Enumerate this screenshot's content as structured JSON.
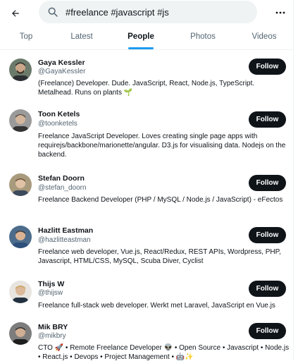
{
  "search": {
    "query": "#freelance #javascript #js"
  },
  "tabs": [
    {
      "label": "Top"
    },
    {
      "label": "Latest"
    },
    {
      "label": "People"
    },
    {
      "label": "Photos"
    },
    {
      "label": "Videos"
    }
  ],
  "active_tab": "People",
  "follow_label": "Follow",
  "users": [
    {
      "name": "Gaya Kessler",
      "handle": "@GayaKessler",
      "bio": "(Freelance) Developer. Dude. JavaScript, React, Node.js, TypeScript. Metalhead. Runs on plants 🌱"
    },
    {
      "name": "Toon Ketels",
      "handle": "@toonketels",
      "bio": "Freelance JavaScript Developer. Loves creating single page apps with requirejs/backbone/marionette/angular. D3.js for visualising data. Nodejs on the backend."
    },
    {
      "name": "Stefan Doorn",
      "handle": "@stefan_doorn",
      "bio": "Freelance Backend Developer (PHP / MySQL / Node.js / JavaScript) - eFectos"
    },
    {
      "name": "Hazlitt Eastman",
      "handle": "@hazlitteastman",
      "bio": "Freelance web developer, Vue.js, React/Redux, REST APIs, Wordpress, PHP, Javascript, HTML/CSS, MySQL, Scuba Diver, Cyclist"
    },
    {
      "name": "Thijs W",
      "handle": "@thijsw",
      "bio": "Freelance full-stack web developer. Werkt met Laravel, JavaScript en Vue.js"
    },
    {
      "name": "Mik BRY",
      "handle": "@mikbry",
      "bio": "CTO 🚀 • Remote Freelance Developer 👽 • Open Source • Javascript • Node.js • React.js • Devops • Project Management • 🤖✨"
    }
  ],
  "icons": {
    "back": "arrow-left-icon",
    "search": "search-icon",
    "more": "more-horizontal-icon"
  },
  "colors": {
    "accent": "#1d9bf0",
    "follow_button": "#0f1419",
    "secondary_text": "#536471",
    "search_bg": "#eff3f4"
  }
}
